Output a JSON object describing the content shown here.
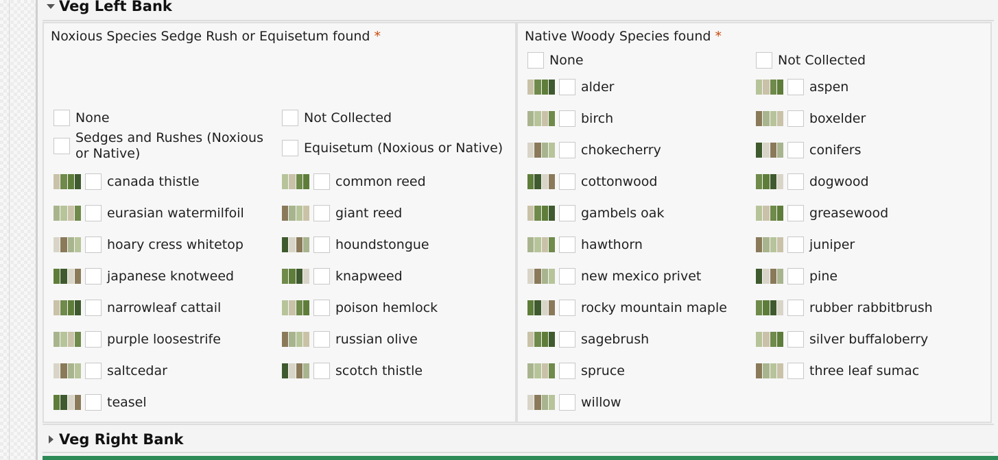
{
  "sections": {
    "left_bank": {
      "label": "Veg Left Bank",
      "expanded": true
    },
    "right_bank": {
      "label": "Veg Right Bank",
      "expanded": false
    }
  },
  "noxious": {
    "question": "Noxious Species Sedge Rush or Equisetum found",
    "required_marker": "*",
    "special_options": [
      "None",
      "Not Collected",
      "Sedges and Rushes (Noxious or Native)",
      "Equisetum (Noxious or Native)"
    ],
    "species": [
      "canada thistle",
      "common reed",
      "eurasian watermilfoil",
      "giant reed",
      "hoary cress whitetop",
      "houndstongue",
      "japanese knotweed",
      "knapweed",
      "narrowleaf cattail",
      "poison hemlock",
      "purple loosestrife",
      "russian olive",
      "saltcedar",
      "scotch thistle",
      "teasel"
    ]
  },
  "woody": {
    "question": "Native Woody Species found",
    "required_marker": "*",
    "special_options": [
      "None",
      "Not Collected"
    ],
    "species": [
      "alder",
      "aspen",
      "birch",
      "boxelder",
      "chokecherry",
      "conifers",
      "cottonwood",
      "dogwood",
      "gambels oak",
      "greasewood",
      "hawthorn",
      "juniper",
      "new mexico privet",
      "pine",
      "rocky mountain maple",
      "rubber rabbitbrush",
      "sagebrush",
      "silver buffaloberry",
      "spruce",
      "three leaf sumac",
      "willow"
    ]
  },
  "colors": {
    "required": "#c94a0a",
    "bottom_bar": "#2e8b57",
    "thumb_palette": [
      "#6f8a4a",
      "#a8b48e",
      "#3f5a2e",
      "#c9c2a8",
      "#8a7a5a",
      "#5e7d3a",
      "#b7c49a",
      "#d8d5c8"
    ]
  }
}
